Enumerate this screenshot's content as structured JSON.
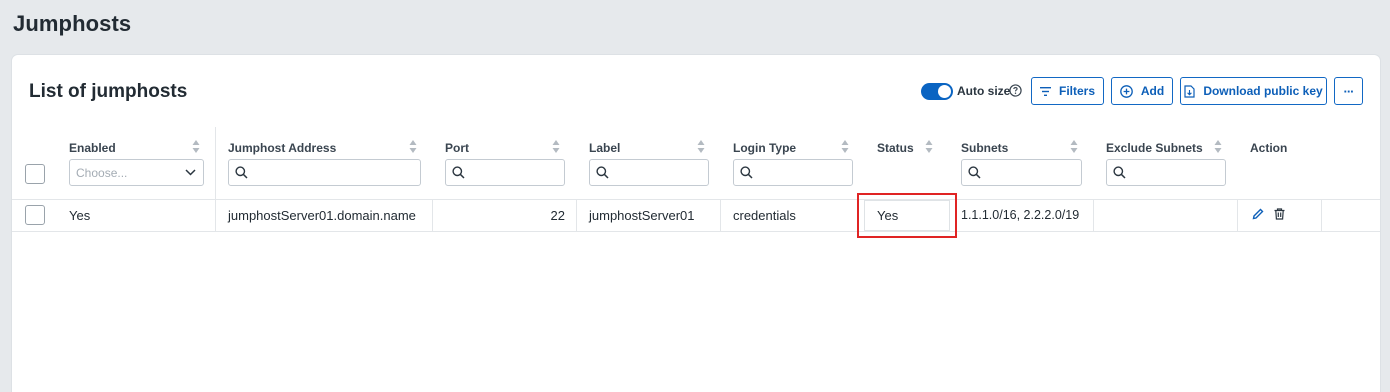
{
  "page": {
    "title": "Jumphosts"
  },
  "card": {
    "title": "List of jumphosts"
  },
  "toolbar": {
    "auto_size_label": "Auto size",
    "auto_size_on": true,
    "filters_label": "Filters",
    "add_label": "Add",
    "download_label": "Download public key",
    "more_label": "···"
  },
  "table": {
    "columns": [
      {
        "label": "Enabled",
        "filter": "select",
        "placeholder": "Choose..."
      },
      {
        "label": "Jumphost Address",
        "filter": "search"
      },
      {
        "label": "Port",
        "filter": "search"
      },
      {
        "label": "Label",
        "filter": "search"
      },
      {
        "label": "Login Type",
        "filter": "search"
      },
      {
        "label": "Status",
        "filter": "none"
      },
      {
        "label": "Subnets",
        "filter": "search"
      },
      {
        "label": "Exclude Subnets",
        "filter": "search"
      },
      {
        "label": "Action",
        "filter": "none"
      }
    ],
    "rows": [
      {
        "enabled": "Yes",
        "address": "jumphostServer01.domain.name",
        "port": "22",
        "label": "jumphostServer01",
        "login_type": "credentials",
        "status": "Yes",
        "subnets": "1.1.1.0/16, 2.2.2.0/19",
        "exclude_subnets": ""
      }
    ]
  },
  "colors": {
    "accent": "#0a64c2",
    "highlight": "#e02424",
    "background": "#e6e9ec"
  }
}
